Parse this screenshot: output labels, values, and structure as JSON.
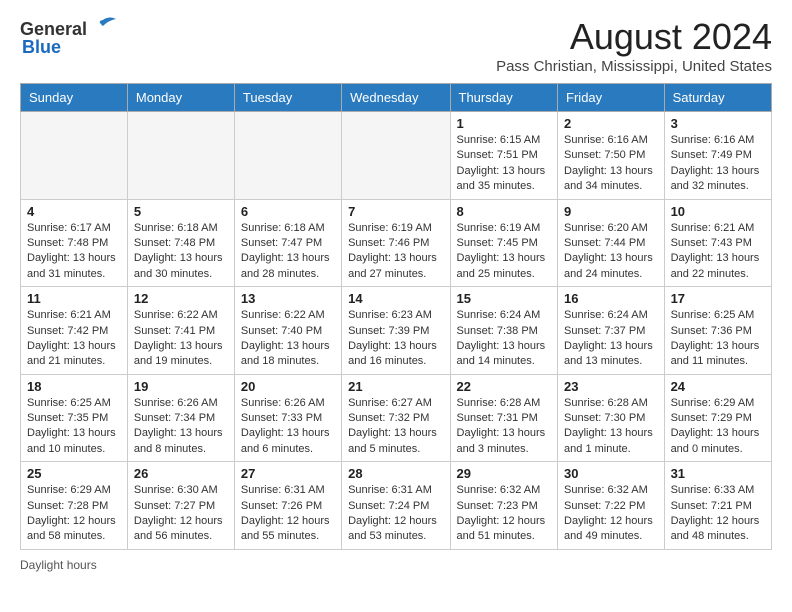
{
  "logo": {
    "general": "General",
    "blue": "Blue"
  },
  "title": "August 2024",
  "location": "Pass Christian, Mississippi, United States",
  "days_of_week": [
    "Sunday",
    "Monday",
    "Tuesday",
    "Wednesday",
    "Thursday",
    "Friday",
    "Saturday"
  ],
  "footer": "Daylight hours",
  "weeks": [
    [
      {
        "day": "",
        "info": ""
      },
      {
        "day": "",
        "info": ""
      },
      {
        "day": "",
        "info": ""
      },
      {
        "day": "",
        "info": ""
      },
      {
        "day": "1",
        "info": "Sunrise: 6:15 AM\nSunset: 7:51 PM\nDaylight: 13 hours and 35 minutes."
      },
      {
        "day": "2",
        "info": "Sunrise: 6:16 AM\nSunset: 7:50 PM\nDaylight: 13 hours and 34 minutes."
      },
      {
        "day": "3",
        "info": "Sunrise: 6:16 AM\nSunset: 7:49 PM\nDaylight: 13 hours and 32 minutes."
      }
    ],
    [
      {
        "day": "4",
        "info": "Sunrise: 6:17 AM\nSunset: 7:48 PM\nDaylight: 13 hours and 31 minutes."
      },
      {
        "day": "5",
        "info": "Sunrise: 6:18 AM\nSunset: 7:48 PM\nDaylight: 13 hours and 30 minutes."
      },
      {
        "day": "6",
        "info": "Sunrise: 6:18 AM\nSunset: 7:47 PM\nDaylight: 13 hours and 28 minutes."
      },
      {
        "day": "7",
        "info": "Sunrise: 6:19 AM\nSunset: 7:46 PM\nDaylight: 13 hours and 27 minutes."
      },
      {
        "day": "8",
        "info": "Sunrise: 6:19 AM\nSunset: 7:45 PM\nDaylight: 13 hours and 25 minutes."
      },
      {
        "day": "9",
        "info": "Sunrise: 6:20 AM\nSunset: 7:44 PM\nDaylight: 13 hours and 24 minutes."
      },
      {
        "day": "10",
        "info": "Sunrise: 6:21 AM\nSunset: 7:43 PM\nDaylight: 13 hours and 22 minutes."
      }
    ],
    [
      {
        "day": "11",
        "info": "Sunrise: 6:21 AM\nSunset: 7:42 PM\nDaylight: 13 hours and 21 minutes."
      },
      {
        "day": "12",
        "info": "Sunrise: 6:22 AM\nSunset: 7:41 PM\nDaylight: 13 hours and 19 minutes."
      },
      {
        "day": "13",
        "info": "Sunrise: 6:22 AM\nSunset: 7:40 PM\nDaylight: 13 hours and 18 minutes."
      },
      {
        "day": "14",
        "info": "Sunrise: 6:23 AM\nSunset: 7:39 PM\nDaylight: 13 hours and 16 minutes."
      },
      {
        "day": "15",
        "info": "Sunrise: 6:24 AM\nSunset: 7:38 PM\nDaylight: 13 hours and 14 minutes."
      },
      {
        "day": "16",
        "info": "Sunrise: 6:24 AM\nSunset: 7:37 PM\nDaylight: 13 hours and 13 minutes."
      },
      {
        "day": "17",
        "info": "Sunrise: 6:25 AM\nSunset: 7:36 PM\nDaylight: 13 hours and 11 minutes."
      }
    ],
    [
      {
        "day": "18",
        "info": "Sunrise: 6:25 AM\nSunset: 7:35 PM\nDaylight: 13 hours and 10 minutes."
      },
      {
        "day": "19",
        "info": "Sunrise: 6:26 AM\nSunset: 7:34 PM\nDaylight: 13 hours and 8 minutes."
      },
      {
        "day": "20",
        "info": "Sunrise: 6:26 AM\nSunset: 7:33 PM\nDaylight: 13 hours and 6 minutes."
      },
      {
        "day": "21",
        "info": "Sunrise: 6:27 AM\nSunset: 7:32 PM\nDaylight: 13 hours and 5 minutes."
      },
      {
        "day": "22",
        "info": "Sunrise: 6:28 AM\nSunset: 7:31 PM\nDaylight: 13 hours and 3 minutes."
      },
      {
        "day": "23",
        "info": "Sunrise: 6:28 AM\nSunset: 7:30 PM\nDaylight: 13 hours and 1 minute."
      },
      {
        "day": "24",
        "info": "Sunrise: 6:29 AM\nSunset: 7:29 PM\nDaylight: 13 hours and 0 minutes."
      }
    ],
    [
      {
        "day": "25",
        "info": "Sunrise: 6:29 AM\nSunset: 7:28 PM\nDaylight: 12 hours and 58 minutes."
      },
      {
        "day": "26",
        "info": "Sunrise: 6:30 AM\nSunset: 7:27 PM\nDaylight: 12 hours and 56 minutes."
      },
      {
        "day": "27",
        "info": "Sunrise: 6:31 AM\nSunset: 7:26 PM\nDaylight: 12 hours and 55 minutes."
      },
      {
        "day": "28",
        "info": "Sunrise: 6:31 AM\nSunset: 7:24 PM\nDaylight: 12 hours and 53 minutes."
      },
      {
        "day": "29",
        "info": "Sunrise: 6:32 AM\nSunset: 7:23 PM\nDaylight: 12 hours and 51 minutes."
      },
      {
        "day": "30",
        "info": "Sunrise: 6:32 AM\nSunset: 7:22 PM\nDaylight: 12 hours and 49 minutes."
      },
      {
        "day": "31",
        "info": "Sunrise: 6:33 AM\nSunset: 7:21 PM\nDaylight: 12 hours and 48 minutes."
      }
    ]
  ]
}
